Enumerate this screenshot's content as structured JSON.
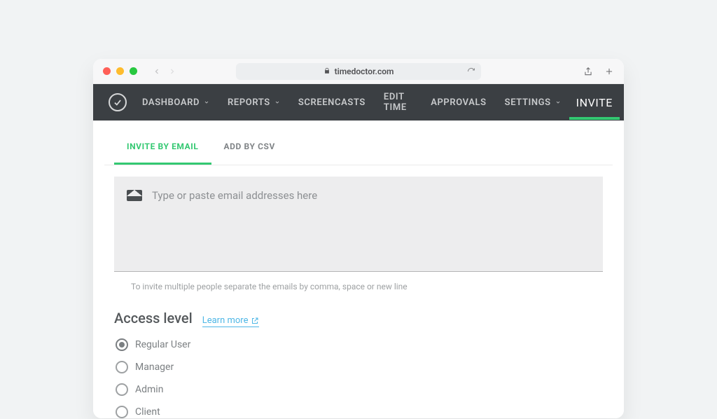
{
  "browser": {
    "url_host": "timedoctor.com"
  },
  "header": {
    "nav": {
      "dashboard": "DASHBOARD",
      "reports": "REPORTS",
      "screencasts": "SCREENCASTS",
      "edit_time": "EDIT TIME",
      "approvals": "APPROVALS",
      "settings": "SETTINGS",
      "invite": "INVITE"
    }
  },
  "tabs": {
    "by_email": "INVITE BY EMAIL",
    "by_csv": "ADD BY CSV"
  },
  "email_input": {
    "placeholder": "Type or paste email addresses here",
    "hint": "To invite multiple people separate the emails by comma, space or new line"
  },
  "access": {
    "title": "Access level",
    "learn_more": "Learn more",
    "options": {
      "regular": "Regular User",
      "manager": "Manager",
      "admin": "Admin",
      "client": "Client"
    },
    "selected": "regular"
  }
}
